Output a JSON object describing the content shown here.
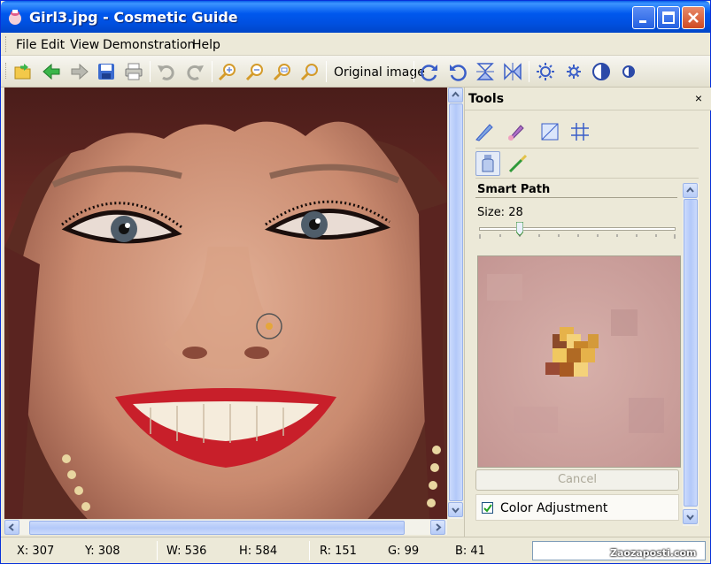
{
  "window": {
    "title": "Girl3.jpg - Cosmetic Guide",
    "accent": "#0054e3"
  },
  "menu": {
    "items": [
      "File",
      "Edit",
      "View",
      "Demonstration",
      "Help"
    ]
  },
  "toolbar": {
    "original_image_label": "Original image",
    "icons": [
      "open-folder-icon",
      "back-arrow-icon",
      "forward-arrow-icon",
      "save-icon",
      "print-icon",
      "undo-icon",
      "redo-icon",
      "zoom-in-icon",
      "zoom-out-icon",
      "zoom-fit-icon",
      "zoom-actual-icon",
      "rotate-right-icon",
      "rotate-left-icon",
      "flip-vertical-icon",
      "flip-horizontal-icon",
      "brightness-up-icon",
      "brightness-down-icon",
      "contrast-up-icon",
      "contrast-down-icon"
    ]
  },
  "tools_panel": {
    "title": "Tools",
    "close_label": "×",
    "section_title": "Smart Path",
    "size_label": "Size: 28",
    "size_value": 28,
    "cancel_label": "Cancel",
    "color_adjustment_label": "Color Adjustment",
    "color_adjustment_checked": true
  },
  "status": {
    "x": "X: 307",
    "y": "Y: 308",
    "w": "W: 536",
    "h": "H: 584",
    "r": "R: 151",
    "g": "G: 99",
    "b": "B: 41"
  },
  "watermark": "Zaozaposti.com"
}
